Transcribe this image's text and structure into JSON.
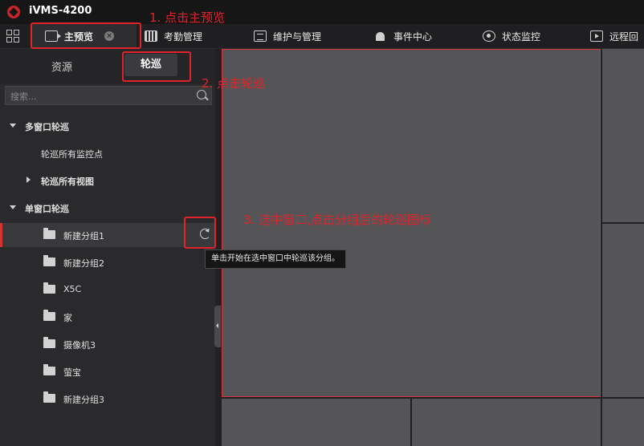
{
  "app": {
    "title": "iVMS-4200"
  },
  "toolbar": {
    "tabs": [
      {
        "label": "主预览",
        "icon": "camera-icon"
      },
      {
        "label": "考勤管理",
        "icon": "calendar-icon"
      },
      {
        "label": "维护与管理",
        "icon": "maintenance-icon"
      },
      {
        "label": "事件中心",
        "icon": "alarm-light-icon"
      },
      {
        "label": "状态监控",
        "icon": "status-monitor-icon"
      },
      {
        "label": "远程回",
        "icon": "playback-icon"
      }
    ]
  },
  "sidebar": {
    "subtabs": [
      {
        "label": "资源"
      },
      {
        "label": "轮巡"
      }
    ],
    "search": {
      "placeholder": "搜索..."
    },
    "tree": {
      "multi_window": {
        "label": "多窗口轮巡",
        "items": [
          {
            "label": "轮巡所有监控点"
          },
          {
            "label": "轮巡所有视图"
          }
        ]
      },
      "single_window": {
        "label": "单窗口轮巡",
        "groups": [
          {
            "label": "新建分组1"
          },
          {
            "label": "新建分组2"
          },
          {
            "label": "X5C"
          },
          {
            "label": "家"
          },
          {
            "label": "摄像机3"
          },
          {
            "label": "萤宝"
          },
          {
            "label": "新建分组3"
          }
        ]
      }
    },
    "tooltip": "单击开始在选中窗口中轮巡该分组。"
  },
  "annotations": {
    "step1": "1. 点击主预览",
    "step2": "2. 点击轮巡",
    "step3": "3. 选中窗口,点击分组后的轮巡图标"
  },
  "colors": {
    "accent": "#e0232a",
    "selected_border": "#d8343a",
    "logo": "#c8262a"
  }
}
